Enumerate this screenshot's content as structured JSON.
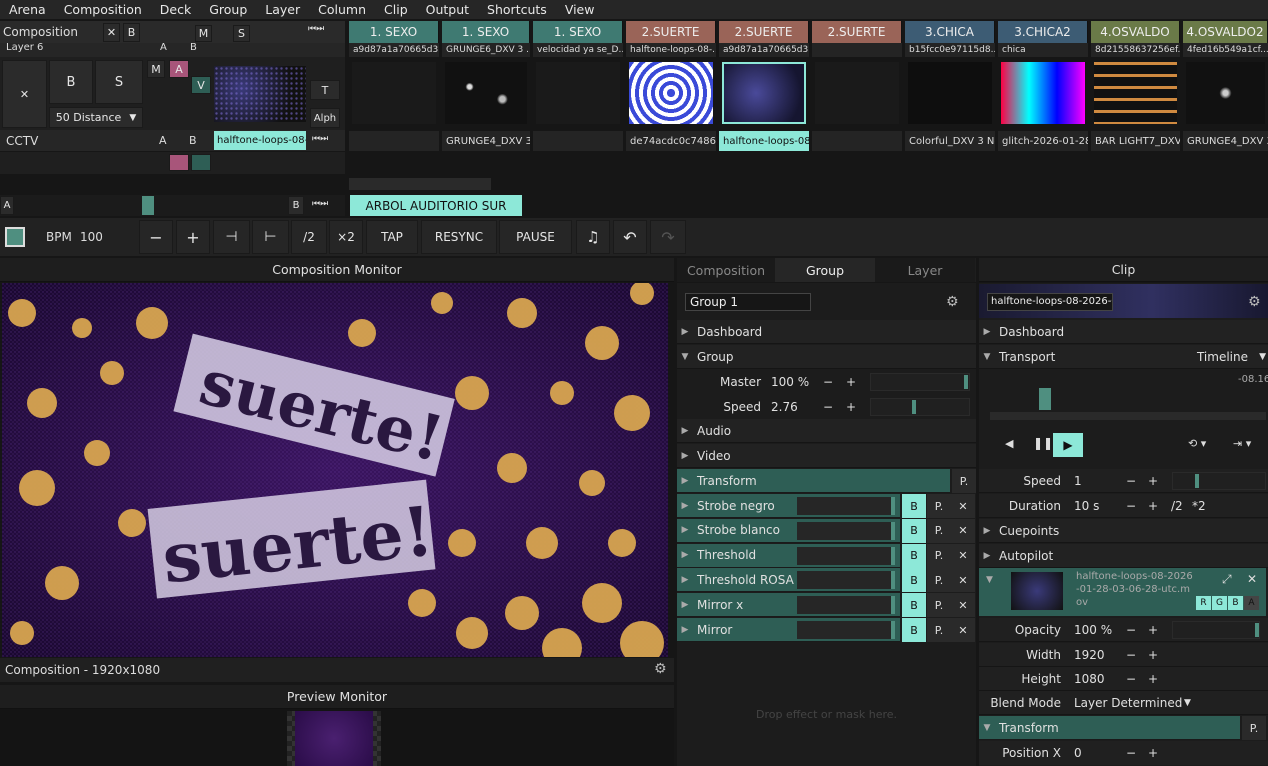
{
  "menu": [
    "Arena",
    "Composition",
    "Deck",
    "Group",
    "Layer",
    "Column",
    "Clip",
    "Output",
    "Shortcuts",
    "View"
  ],
  "comp_label": "Composition",
  "comp_x": "✕",
  "comp_b": "B",
  "comp_m": "M",
  "comp_s": "S",
  "columns": [
    {
      "label": "1. SEXO",
      "color": "#3f7a72"
    },
    {
      "label": "1. SEXO",
      "color": "#3f7a72"
    },
    {
      "label": "1. SEXO",
      "color": "#3f7a72"
    },
    {
      "label": "2.SUERTE",
      "color": "#9a6458"
    },
    {
      "label": "2.SUERTE",
      "color": "#9a6458"
    },
    {
      "label": "2.SUERTE",
      "color": "#9a6458"
    },
    {
      "label": "3.CHICA",
      "color": "#3d5c74"
    },
    {
      "label": "3.CHICA2",
      "color": "#3d5c74"
    },
    {
      "label": "4.OSVALDO",
      "color": "#6a7a48"
    },
    {
      "label": "4.OSVALDO2",
      "color": "#6a7a48"
    }
  ],
  "top_row": {
    "layer": "Layer 6",
    "a": "A",
    "b": "B",
    "clips": [
      "a9d87a1a70665d3...",
      "GRUNGE6_DXV 3 ...",
      "velocidad ya se_D...",
      "halftone-loops-08-...",
      "a9d87a1a70665d3...",
      "",
      "b15fcc0e97115d8...",
      "chica",
      "8d21558637256ef...",
      "4fed16b549a1cf..."
    ]
  },
  "layer": {
    "x": "✕",
    "b": "B",
    "s": "S",
    "m": "M",
    "a": "A",
    "v": "V",
    "t": "T",
    "alph": "Alph",
    "distance": "50 Distance",
    "name": "CCTV",
    "la": "A",
    "lb": "B",
    "clip": "halftone-loops-08-..."
  },
  "clips": [
    "",
    "GRUNGE4_DXV 3 ...",
    "",
    "de74acdc0c74863...",
    "halftone-loops-08...",
    "",
    "Colorful_DXV 3 No...",
    "glitch-2026-01-28-...",
    "BAR LIGHT7_DXV ...",
    "GRUNGE4_DXV 3 ..."
  ],
  "deck": {
    "a": "A",
    "b": "B",
    "name": "ARBOL AUDITORIO SUR"
  },
  "transport": {
    "bpm_label": "BPM",
    "bpm": "100",
    "minus": "−",
    "plus": "+",
    "half": "/2",
    "double": "×2",
    "tap": "TAP",
    "resync": "RESYNC",
    "pause": "PAUSE"
  },
  "monitor": {
    "title": "Composition Monitor",
    "footer": "Composition - 1920x1080",
    "preview": "Preview Monitor",
    "word1": "suerte!",
    "word2": "suerte!"
  },
  "group": {
    "tabs": [
      "Composition",
      "Group",
      "Layer"
    ],
    "name": "Group 1",
    "dashboard": "Dashboard",
    "group": "Group",
    "master_label": "Master",
    "master": "100 %",
    "speed_label": "Speed",
    "speed": "2.76",
    "audio": "Audio",
    "video": "Video",
    "transform": "Transform",
    "p": "P.",
    "effects": [
      "Strobe negro",
      "Strobe blanco",
      "Threshold",
      "Threshold ROSA",
      "Mirror x",
      "Mirror"
    ],
    "b": "B",
    "x": "✕",
    "drop": "Drop effect or mask here.",
    "master_frac": 0.99,
    "speed_frac": 0.44
  },
  "clip": {
    "title": "Clip",
    "name": "halftone-loops-08-2026-01-...",
    "dashboard": "Dashboard",
    "transport": "Transport",
    "timeline": "Timeline",
    "time": "-08.16",
    "speed_label": "Speed",
    "speed": "1",
    "duration_label": "Duration",
    "duration": "10 s",
    "half": "/2",
    "double": "*2",
    "cuepoints": "Cuepoints",
    "autopilot": "Autopilot",
    "file": "halftone-loops-08-2026-01-28-03-06-28-utc.mov",
    "r": "R",
    "g": "G",
    "b2": "B",
    "a": "A",
    "opacity_label": "Opacity",
    "opacity": "100 %",
    "width_label": "Width",
    "width": "1920",
    "height_label": "Height",
    "height": "1080",
    "blend_label": "Blend Mode",
    "blend": "Layer Determined",
    "transform": "Transform",
    "posx_label": "Position X",
    "posx": "0",
    "minus": "−",
    "plus": "+",
    "p": "P.",
    "playhead_frac": 0.2
  }
}
